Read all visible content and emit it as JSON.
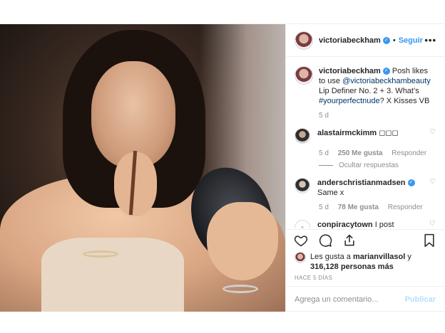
{
  "header": {
    "username": "victoriabeckham",
    "separator": "•",
    "follow_label": "Seguir",
    "more_label": "•••"
  },
  "caption": {
    "username": "victoriabeckham",
    "text_before": "Posh likes to use ",
    "mention": "@victoriabeckhambeauty",
    "text_middle": " Lip Definer No. 2 + 3. What’s ",
    "hashtag": "#yourperfectnude",
    "text_after": "? X Kisses VB",
    "time": "5 d"
  },
  "comments": [
    {
      "username": "alastairmckimm",
      "text": "◻◻◻",
      "time": "5 d",
      "likes": "250 Me gusta",
      "reply_label": "Responder",
      "hide_replies": "Ocultar respuestas"
    },
    {
      "username": "anderschristianmadsen",
      "text": "Same x",
      "time": "5 d",
      "likes": "78 Me gusta",
      "reply_label": "Responder"
    },
    {
      "username": "conpiracytown",
      "text": "I post"
    }
  ],
  "likes": {
    "prefix": "Les gusta a ",
    "user": "marianvillasol",
    "middle": " y ",
    "count": "316,128 personas más"
  },
  "timestamp": "HACE 5 DÍAS",
  "add_comment": {
    "placeholder": "Agrega un comentario...",
    "post_label": "Publicar"
  },
  "icons": {
    "like": "heart-icon",
    "comment": "comment-icon",
    "share": "share-icon",
    "save": "bookmark-icon"
  }
}
